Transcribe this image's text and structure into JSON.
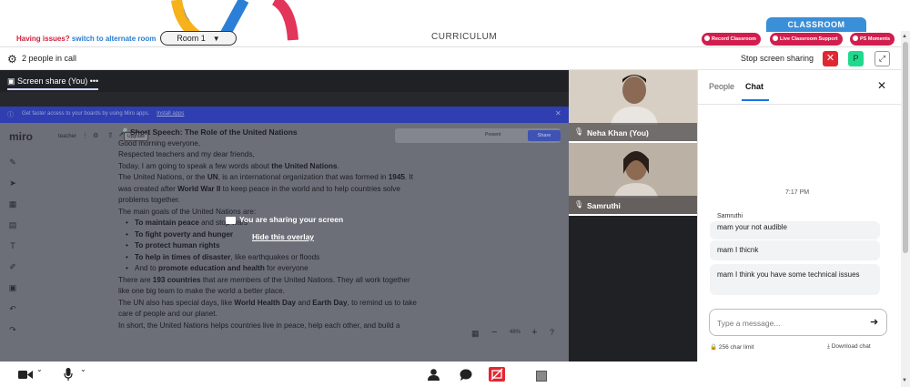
{
  "topbar": {
    "help_text": "Having issues?",
    "help_link": "switch to alternate room",
    "room_label": "Room 1",
    "curriculum": "CURRICULUM",
    "classroom_tab": "CLASSROOM",
    "pills": [
      "Record Classroom",
      "Live Classroom Support",
      "PS Moments"
    ]
  },
  "callbar": {
    "people_count": "2 people in call",
    "stop_share": "Stop screen sharing",
    "p_label": "P"
  },
  "share": {
    "tab_label": "Screen share (You)",
    "tab_menu": "•••",
    "banner_text": "Get faster access to your boards by using Miro apps.",
    "banner_link": "Install apps",
    "overlay_message": "You are sharing your screen",
    "overlay_hide": "Hide this overlay",
    "miro": {
      "logo": "miro",
      "board_name": "teacher",
      "upgrade": "Upgrade",
      "present": "Present",
      "share": "Share",
      "zoom": "48%"
    },
    "doc": {
      "title": "Short Speech: The Role of the United Nations",
      "l1": "Good morning everyone,",
      "l2": " Respected teachers and my dear friends,",
      "l3a": "Today, I am going to speak a few words about ",
      "l3b": "the United Nations",
      "l3c": ".",
      "l4a": "The United Nations, or the ",
      "l4b": "UN",
      "l4c": ", is an international organization that was formed in ",
      "l4d": "1945",
      "l4e": ". It",
      "l5a": "was created after ",
      "l5b": "World War II",
      "l5c": " to keep peace in the world and to help countries solve",
      "l6": "problems together.",
      "l7": "The main goals of the United Nations are:",
      "b1a": "To maintain peace",
      "b1b": " and stop wars",
      "b2": "To fight poverty and hunger",
      "b3": "To protect human rights",
      "b4a": "To help in times of disaster",
      "b4b": ", like earthquakes or floods",
      "b5a": "And to ",
      "b5b": "promote education and health",
      "b5c": " for everyone",
      "l8a": "There are ",
      "l8b": "193 countries",
      "l8c": " that are members of the United Nations. They all work together",
      "l9": "like one big team to make the world a better place.",
      "l10a": "The UN also has special days, like ",
      "l10b": "World Health Day",
      "l10c": " and ",
      "l10d": "Earth Day",
      "l10e": ", to remind us to take",
      "l11": "care of people and our planet.",
      "l12": "In short, the United Nations helps countries live in peace, help each other, and build a"
    }
  },
  "participants": [
    {
      "name": "Neha Khan (You)"
    },
    {
      "name": "Samruthi"
    }
  ],
  "chat": {
    "tab_people": "People",
    "tab_chat": "Chat",
    "time": "7:17 PM",
    "sender": "Samruthi",
    "messages": [
      "mam your not audible",
      "mam I thicnk",
      "mam I think you have some technical issues"
    ],
    "placeholder": "Type a message...",
    "char_limit": "256 char limit",
    "download": "Download chat"
  },
  "icons": {
    "gear": "gear-icon",
    "close": "close-icon",
    "send": "send-icon",
    "mic": "mic-icon",
    "camera": "camera-icon",
    "lock": "lock-icon",
    "download": "download-icon"
  },
  "colors": {
    "accent_blue": "#3a8fd9",
    "alert_red": "#d11e4f",
    "stop_red": "#e02732",
    "avatar_green": "#1eda8c"
  }
}
